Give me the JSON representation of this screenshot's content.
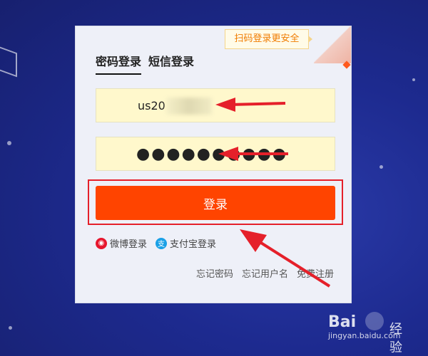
{
  "qr_tip": "扫码登录更安全",
  "tabs": [
    {
      "label": "密码登录",
      "active": true
    },
    {
      "label": "短信登录",
      "active": false
    }
  ],
  "username_field": {
    "value": "us20",
    "visible_prefix": "us",
    "visible_suffix": "20"
  },
  "password_field": {
    "value": "●●●●●●●●●●"
  },
  "login_button": "登录",
  "third_party": [
    {
      "label": "微博登录",
      "icon": "weibo-icon"
    },
    {
      "label": "支付宝登录",
      "icon": "alipay-icon"
    }
  ],
  "bottom_links": [
    "忘记密码",
    "忘记用户名",
    "免费注册"
  ],
  "watermark": {
    "main": "Bai",
    "cn": "经验",
    "sub": "jingyan.baidu.com"
  },
  "colors": {
    "background": "#1d2a8f",
    "accent": "#ff4400",
    "highlight": "#e5202a",
    "field_bg": "#fff8cc"
  }
}
